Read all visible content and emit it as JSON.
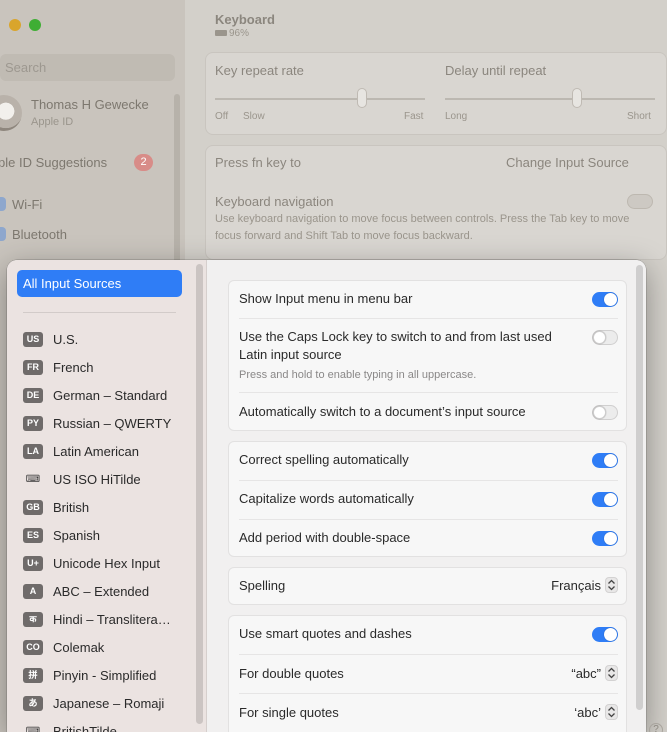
{
  "background": {
    "search_placeholder": "Search",
    "user": {
      "name": "Thomas H Gewecke",
      "subtitle": "Apple ID"
    },
    "suggestions": {
      "label": "ple ID Suggestions",
      "count": "2"
    },
    "sidebar_items": [
      "Wi-Fi",
      "Bluetooth"
    ],
    "header": {
      "title": "Keyboard",
      "battery": "96%"
    },
    "key_repeat": {
      "label": "Key repeat rate",
      "min": "Off",
      "slow": "Slow",
      "max": "Fast",
      "level": 0.7
    },
    "delay_repeat": {
      "label": "Delay until repeat",
      "min": "Long",
      "max": "Short",
      "level": 0.63
    },
    "fn_key": {
      "label": "Press fn key to",
      "value": "Change Input Source"
    },
    "keyboard_nav": {
      "label": "Keyboard navigation",
      "description": "Use keyboard navigation to move focus between controls. Press the Tab key to move focus forward and Shift Tab to move focus backward.",
      "enabled": false
    }
  },
  "sources": {
    "all_label": "All Input Sources",
    "items": [
      {
        "badge": "US",
        "name": "U.S."
      },
      {
        "badge": "FR",
        "name": "French"
      },
      {
        "badge": "DE",
        "name": "German – Standard"
      },
      {
        "badge": "PY",
        "name": "Russian – QWERTY"
      },
      {
        "badge": "LA",
        "name": "Latin American"
      },
      {
        "badge": "⌨",
        "name": "US ISO HiTilde"
      },
      {
        "badge": "GB",
        "name": "British"
      },
      {
        "badge": "ES",
        "name": "Spanish"
      },
      {
        "badge": "U+",
        "name": "Unicode Hex Input"
      },
      {
        "badge": "A",
        "name": "ABC – Extended"
      },
      {
        "badge": "क",
        "name": "Hindi – Translitera…"
      },
      {
        "badge": "CO",
        "name": "Colemak"
      },
      {
        "badge": "拼",
        "name": "Pinyin - Simplified"
      },
      {
        "badge": "あ",
        "name": "Japanese – Romaji"
      },
      {
        "badge": "⌨",
        "name": "BritishTilde"
      }
    ]
  },
  "options": {
    "show_input_menu": {
      "label": "Show Input menu in menu bar",
      "enabled": true
    },
    "caps_lock": {
      "label": "Use the Caps Lock key to switch to and from last used Latin input source",
      "sub": "Press and hold to enable typing in all uppercase.",
      "enabled": false
    },
    "auto_switch": {
      "label": "Automatically switch to a document’s input source",
      "enabled": false
    },
    "correct_spelling": {
      "label": "Correct spelling automatically",
      "enabled": true
    },
    "capitalize": {
      "label": "Capitalize words automatically",
      "enabled": true
    },
    "period": {
      "label": "Add period with double-space",
      "enabled": true
    },
    "spelling": {
      "label": "Spelling",
      "value": "Français"
    },
    "smart_quotes": {
      "label": "Use smart quotes and dashes",
      "enabled": true
    },
    "double_quotes": {
      "label": "For double quotes",
      "value": "“abc”"
    },
    "single_quotes": {
      "label": "For single quotes",
      "value": "‘abc’"
    }
  },
  "colors": {
    "accent": "#2f7df6",
    "badge_red": "#d88c88"
  }
}
